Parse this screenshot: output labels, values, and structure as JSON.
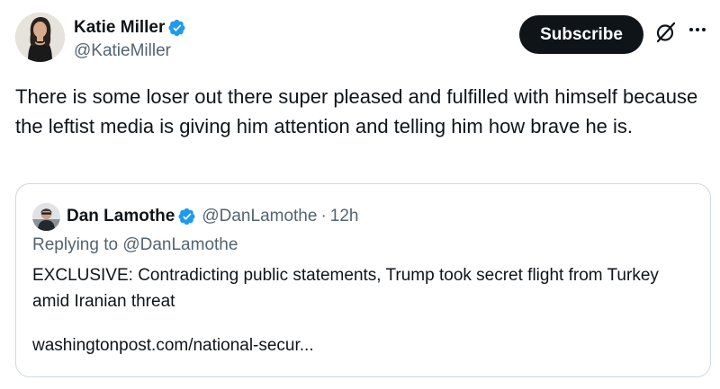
{
  "author": {
    "display_name": "Katie Miller",
    "handle": "@KatieMiller",
    "verified": true
  },
  "actions": {
    "subscribe_label": "Subscribe",
    "grok_icon": "grok-icon",
    "more_icon": "more-horizontal-icon"
  },
  "tweet": {
    "text": "There is some loser out there super pleased and fulfilled with himself because the leftist media is giving him attention and telling him how brave he is."
  },
  "quote": {
    "display_name": "Dan Lamothe",
    "handle": "@DanLamothe",
    "separator": "·",
    "time": "12h",
    "replying_prefix": "Replying to ",
    "replying_to": "@DanLamothe",
    "text": "EXCLUSIVE: Contradicting public statements, Trump took secret flight from Turkey amid Iranian threat",
    "url": "washingtonpost.com/national-secur..."
  },
  "colors": {
    "text": "#0f1419",
    "secondary": "#536471",
    "verified": "#1d9bf0",
    "border": "#cfd9de"
  }
}
